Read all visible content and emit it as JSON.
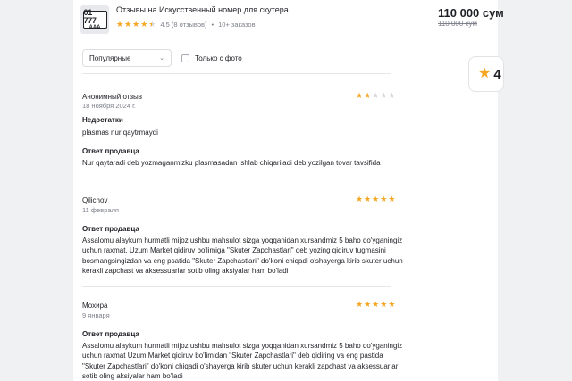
{
  "product": {
    "title": "Отзывы на Искусственный номер для скутера",
    "plate_line1": "01 777",
    "plate_line2": "AAA",
    "rating": 4.5,
    "rating_text": "4.5 (8 отзывов)",
    "dot": "•",
    "orders": "10+ заказов",
    "price": "110 000 сум",
    "old_price": "110 000 сум"
  },
  "side_card": {
    "rating_text": "4"
  },
  "filters": {
    "sort_label": "Популярные",
    "photo_only_label": "Только с фото",
    "photo_only_checked": false
  },
  "reviews": [
    {
      "author": "Анонимный отзыв",
      "date": "18 ноября 2024 г.",
      "rating": 2,
      "cons_label": "Недостатки",
      "cons_text": "plasmas nur qaytrmaydi",
      "reply_label": "Ответ продавца",
      "reply_lines": [
        "Nur qaytaradi deb yozmaganmizku plasmasadan ishlab chiqariladi deb yozilgan tovar tavsifida"
      ]
    },
    {
      "author": "Qilichov",
      "date": "11 февраля",
      "rating": 5,
      "reply_label": "Ответ продавца",
      "reply_lines": [
        "Assalomu alaykum hurmatli mijoz ushbu mahsulot sizga yoqqanidan xursandmiz 5 baho qo'yganingiz",
        "uchun raxmat. Uzum Market qidiruv bo'limiga \"Skuter Zapchastlari\" deb yozing qidiruv tugmasini",
        "bosmangsingizdan va eng psatida \"Skuter Zapchastlari\" do'koni chiqadi o'shayerga kirib skuter uchun",
        "kerakli zapchast va aksessuarlar sotib oling aksiyalar ham bo'ladi"
      ]
    },
    {
      "author": "Мохира",
      "date": "9 января",
      "rating": 5,
      "reply_label": "Ответ продавца",
      "reply_lines": [
        "Assalomu alaykum hurmatli mijoz ushbu mahsulot sizga yoqqanidan xursandmiz 5 baho qo'yganingiz",
        "uchun raxmat Uzum Market qidiruv bo'limidan \"Skuter Zapchastlari\" deb qidiring va eng pastida",
        "\"Skuter Zapchastlari\" do'koni chiqadi o'shayerga kirib skuter uchun kerakli zapchast va aksessuarlar",
        "sotib oling aksiyalar ham bo'ladi"
      ]
    }
  ],
  "colors": {
    "star": "#f5a623",
    "star_off": "#d4d6db",
    "muted": "#7e818c",
    "text": "#1f2026"
  }
}
